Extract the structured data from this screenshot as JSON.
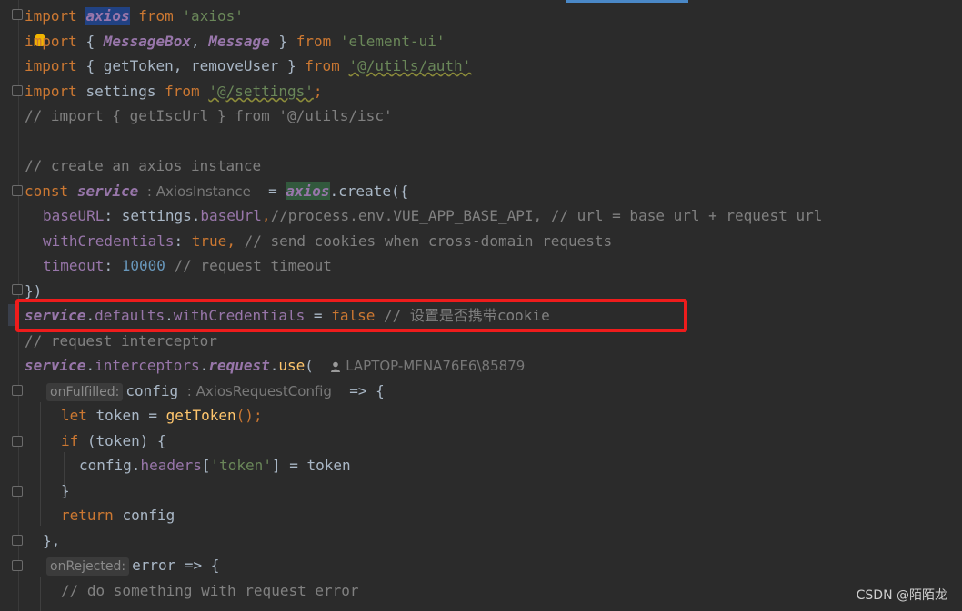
{
  "editor": {
    "lines": {
      "l1": [
        "import",
        "axios",
        "from",
        "'axios'"
      ],
      "l2": [
        "import",
        "{",
        "MessageBox",
        ",",
        "Message",
        "}",
        "from",
        "'element-ui'"
      ],
      "l3": [
        "import",
        "{ getToken, removeUser }",
        "from",
        "'@/utils/auth'"
      ],
      "l4": [
        "import",
        "settings",
        "from",
        "'@/settings'",
        ";"
      ],
      "l5": "// import { getIscUrl } from '@/utils/isc'",
      "l7": "// create an axios instance",
      "l8": [
        "const",
        "service",
        ": AxiosInstance",
        "=",
        "axios",
        ".create({"
      ],
      "l9": [
        "baseURL",
        ": settings.",
        "baseUrl",
        ",",
        "//process.env.VUE_APP_BASE_API, // url = base url + request url"
      ],
      "l10": [
        "withCredentials",
        ":",
        "true",
        ",",
        "// send cookies when cross-domain requests"
      ],
      "l11": [
        "timeout",
        ":",
        "10000",
        "// request timeout"
      ],
      "l12": "})",
      "l13": [
        "service",
        ".",
        "defaults",
        ".",
        "withCredentials",
        " = ",
        "false",
        "// 设置是否携带cookie"
      ],
      "l14": "// request interceptor",
      "l15": [
        "service",
        ".",
        "interceptors",
        ".",
        "request",
        ".",
        "use",
        "(",
        "LAPTOP-MFNA76E6\\85879"
      ],
      "l16": [
        "onFulfilled:",
        "config",
        ": AxiosRequestConfig",
        "=> {"
      ],
      "l17": [
        "let",
        "token = ",
        "getToken",
        "();"
      ],
      "l18": [
        "if",
        "(token) {"
      ],
      "l19": [
        "config.",
        "headers",
        "[",
        "'token'",
        "] = token"
      ],
      "l20": "}",
      "l21": [
        "return",
        "config"
      ],
      "l22": "},",
      "l23": [
        "onRejected:",
        "error => {"
      ],
      "l24": "// do something with request error"
    }
  },
  "watermark": "CSDN @陌陌龙",
  "colors": {
    "background": "#2b2b2b",
    "keyword": "#cc7832",
    "string": "#6a8759",
    "comment": "#808080",
    "field": "#9876aa",
    "number": "#6897bb",
    "highlight_box": "#ee1c1c"
  }
}
